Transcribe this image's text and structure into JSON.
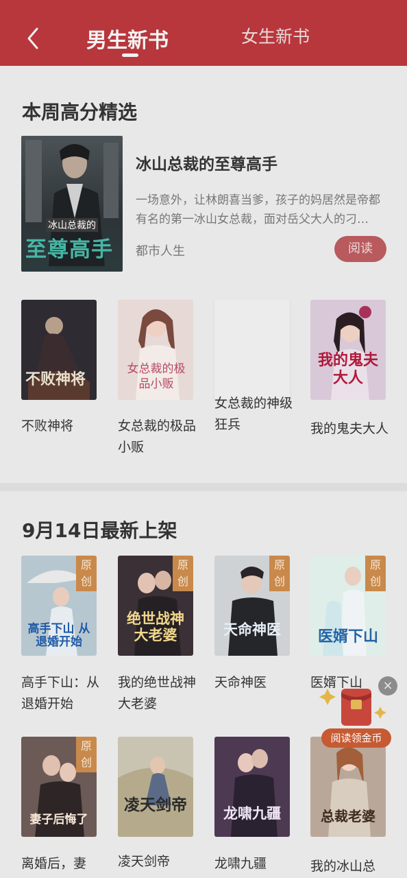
{
  "header": {
    "tabs": [
      {
        "label": "男生新书",
        "active": true
      },
      {
        "label": "女生新书",
        "active": false
      }
    ]
  },
  "weekly": {
    "title": "本周高分精选",
    "featured": {
      "title": "冰山总裁的至尊高手",
      "cover_text_line1": "冰山总裁的",
      "cover_text_line2": "至尊高手",
      "description": "一场意外，让林朗喜当爹，孩子的妈居然是帝都有名的第一冰山女总裁，面对岳父大人的刁…",
      "genre": "都市人生",
      "read_label": "阅读"
    },
    "books": [
      {
        "title": "不败神将",
        "cover_text": "不败神将"
      },
      {
        "title": "女总裁的极品小贩",
        "cover_text": "女总裁的极品小贩"
      },
      {
        "title": "女总裁的神级狂兵",
        "cover_text": ""
      },
      {
        "title": "我的鬼夫大人",
        "cover_text": "我的鬼夫大人"
      }
    ]
  },
  "latest": {
    "title": "9月14日最新上架",
    "badge": "原创",
    "books": [
      {
        "title": "高手下山：从退婚开始",
        "cover_text": "高手下山 从退婚开始",
        "badge": true
      },
      {
        "title": "我的绝世战神大老婆",
        "cover_text": "绝世战神 大老婆",
        "badge": true
      },
      {
        "title": "天命神医",
        "cover_text": "天命神医",
        "badge": true
      },
      {
        "title": "医婿下山",
        "cover_text": "医婿下山",
        "badge": true
      },
      {
        "title": "离婚后，妻",
        "cover_text": "妻子后悔了",
        "badge": true
      },
      {
        "title": "凌天剑帝",
        "cover_text": "凌天剑帝",
        "badge": false
      },
      {
        "title": "龙啸九疆",
        "cover_text": "龙啸九疆",
        "badge": false
      },
      {
        "title": "我的冰山总",
        "cover_text": "总裁老婆",
        "badge": false
      }
    ]
  },
  "floating": {
    "label": "阅读领金币",
    "close": "×"
  },
  "colors": {
    "header": "#b8373c",
    "accent": "#c65a32",
    "background": "#e9e9e9"
  }
}
